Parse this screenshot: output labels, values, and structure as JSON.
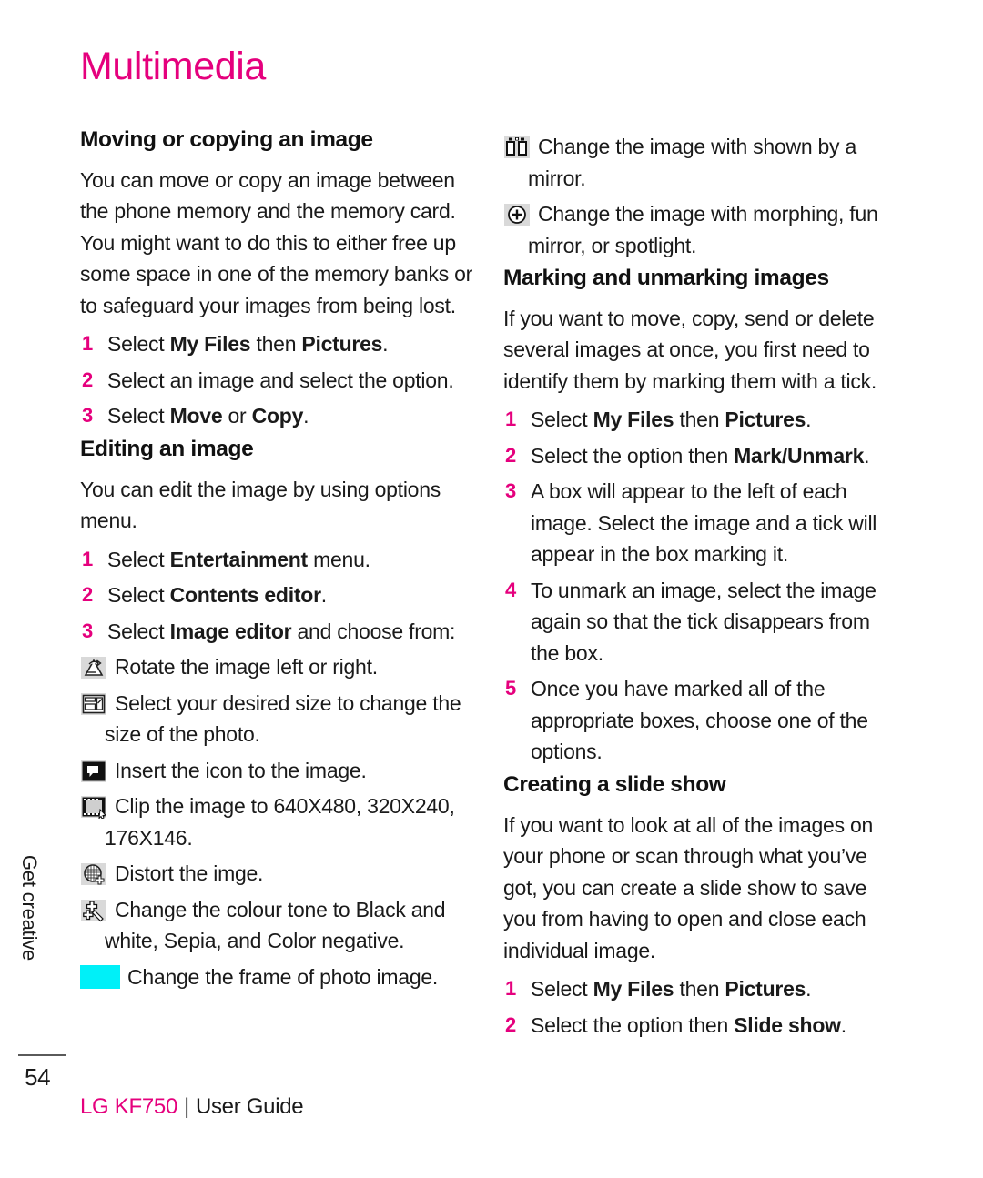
{
  "page": {
    "title": "Multimedia",
    "number": "54",
    "side_tab": "Get creative",
    "accent_color": "#E5007D",
    "swatch_color": "#00F0F8"
  },
  "footer": {
    "brand": "LG KF750",
    "separator": "|",
    "guide": "User Guide"
  },
  "left_column": {
    "section1": {
      "heading": "Moving or copying an image",
      "paragraph": "You can move or copy an image between the phone memory and the memory card. You might want to do this to either free up some space in one of the memory banks or to safeguard your images from being lost.",
      "steps": [
        {
          "num": "1",
          "pre": "Select ",
          "b1": "My Files",
          "mid": " then ",
          "b2": "Pictures",
          "post": "."
        },
        {
          "num": "2",
          "pre": "Select an image and select the option.",
          "b1": "",
          "mid": "",
          "b2": "",
          "post": ""
        },
        {
          "num": "3",
          "pre": "Select ",
          "b1": "Move",
          "mid": " or ",
          "b2": "Copy",
          "post": "."
        }
      ]
    },
    "section2": {
      "heading": "Editing an image",
      "paragraph": "You can edit the image by using options menu.",
      "steps": [
        {
          "num": "1",
          "pre": "Select ",
          "b1": "Entertainment",
          "mid": " menu.",
          "b2": "",
          "post": ""
        },
        {
          "num": "2",
          "pre": "Select ",
          "b1": "Contents editor",
          "mid": "",
          "b2": "",
          "post": "."
        },
        {
          "num": "3",
          "pre": "Select ",
          "b1": "Image editor",
          "mid": " and choose from:",
          "b2": "",
          "post": ""
        }
      ],
      "icon_items": [
        {
          "icon": "rotate-image-icon",
          "text": "Rotate the image left or right."
        },
        {
          "icon": "resize-image-icon",
          "text": "Select your desired size to change the size of the photo."
        },
        {
          "icon": "insert-icon-icon",
          "text": "Insert the icon to the image."
        },
        {
          "icon": "clip-image-icon",
          "text": "Clip the image to 640X480, 320X240, 176X146."
        },
        {
          "icon": "distort-image-icon",
          "text": "Distort the imge."
        },
        {
          "icon": "colour-tone-icon",
          "text": "Change the colour tone to Black and white, Sepia, and Color negative."
        },
        {
          "icon": "frame-swatch-icon",
          "text": "Change the frame of photo image."
        }
      ]
    }
  },
  "right_column": {
    "icon_items_top": [
      {
        "icon": "mirror-image-icon",
        "text": "Change the image with shown by a mirror."
      },
      {
        "icon": "morphing-icon",
        "text": "Change the image with morphing, fun mirror, or spotlight."
      }
    ],
    "section3": {
      "heading": "Marking and unmarking images",
      "paragraph": "If you want to move, copy, send or delete several images at once, you first need to identify them by marking them with a tick.",
      "steps": [
        {
          "num": "1",
          "pre": "Select ",
          "b1": "My Files",
          "mid": " then ",
          "b2": "Pictures",
          "post": "."
        },
        {
          "num": "2",
          "pre": "Select the option then ",
          "b1": "Mark/Unmark",
          "mid": "",
          "b2": "",
          "post": "."
        },
        {
          "num": "3",
          "pre": "A box will appear to the left of each image. Select the image and a tick will appear in the box marking it.",
          "b1": "",
          "mid": "",
          "b2": "",
          "post": ""
        },
        {
          "num": "4",
          "pre": "To unmark an image, select the image again so that the tick disappears from the box.",
          "b1": "",
          "mid": "",
          "b2": "",
          "post": ""
        },
        {
          "num": "5",
          "pre": "Once you have marked all of the appropriate boxes, choose one of the options.",
          "b1": "",
          "mid": "",
          "b2": "",
          "post": ""
        }
      ]
    },
    "section4": {
      "heading": "Creating a slide show",
      "paragraph": "If you want to look at all of the images on your phone or scan through what you’ve got, you can create a slide show to save you from having to open and close each individual image.",
      "steps": [
        {
          "num": "1",
          "pre": "Select ",
          "b1": "My Files",
          "mid": " then ",
          "b2": "Pictures",
          "post": "."
        },
        {
          "num": "2",
          "pre": "Select the option then ",
          "b1": "Slide show",
          "mid": "",
          "b2": "",
          "post": "."
        }
      ]
    }
  }
}
